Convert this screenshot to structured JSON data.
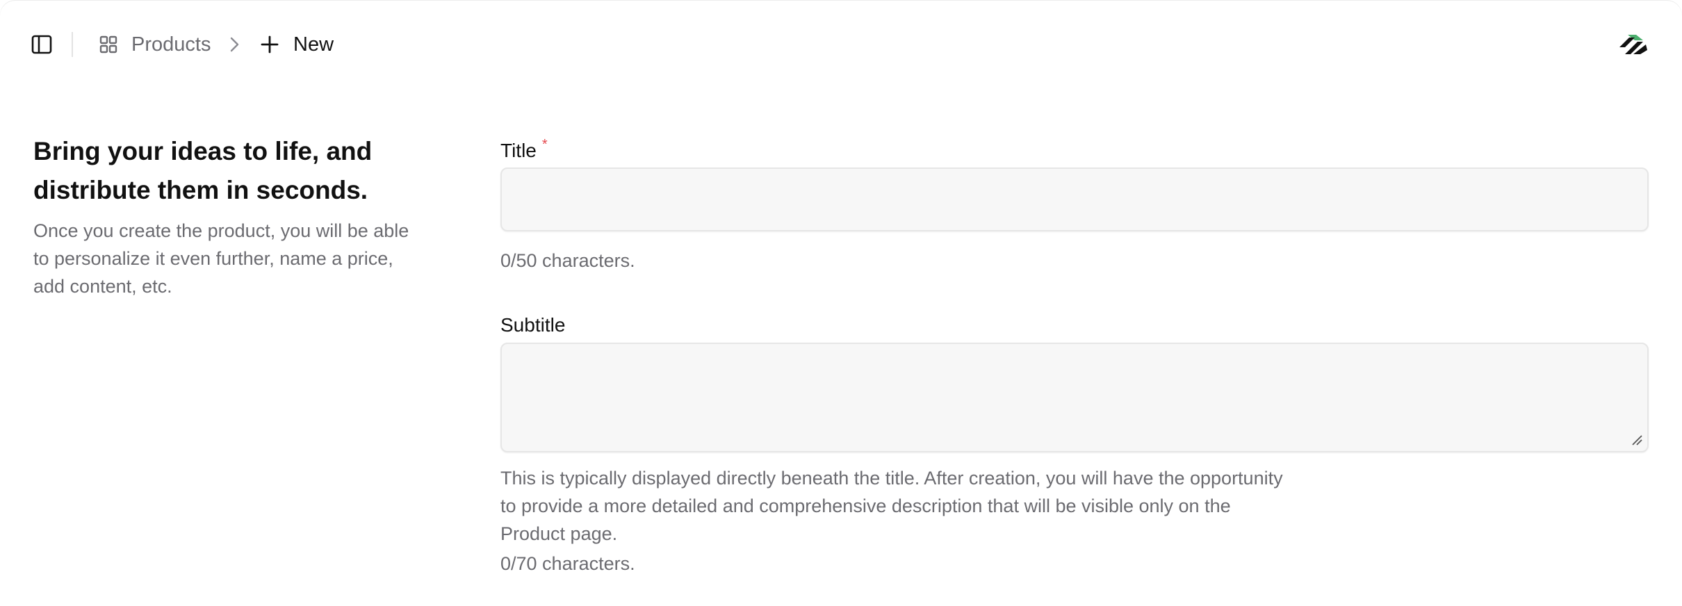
{
  "header": {
    "sidebar_toggle_icon": "sidebar-panel-icon",
    "breadcrumb": {
      "products_icon": "grid-icon",
      "products_label": "Products",
      "separator_icon": "chevron-right-icon",
      "new_icon": "plus-icon",
      "new_label": "New"
    },
    "logo_icon": "brand-logo-icon",
    "logo_accent_color": "#4caf6e"
  },
  "intro": {
    "heading": "Bring your ideas to life, and distribute them in seconds.",
    "description": "Once you create the product, you will be able to personalize it even further, name a price, add content, etc."
  },
  "form": {
    "title": {
      "label": "Title",
      "required_marker": "*",
      "value": "",
      "placeholder": "",
      "counter": "0/50 characters."
    },
    "subtitle": {
      "label": "Subtitle",
      "value": "",
      "placeholder": "",
      "helper": "This is typically displayed directly beneath the title. After creation, you will have the opportunity to provide a more detailed and comprehensive description that will be visible only on the Product page.",
      "counter": "0/70 characters."
    }
  },
  "colors": {
    "text_primary": "#111111",
    "text_muted": "#6b6b70",
    "input_background": "#f7f7f7",
    "input_border": "#e6e6e6",
    "required": "#e5484d"
  }
}
